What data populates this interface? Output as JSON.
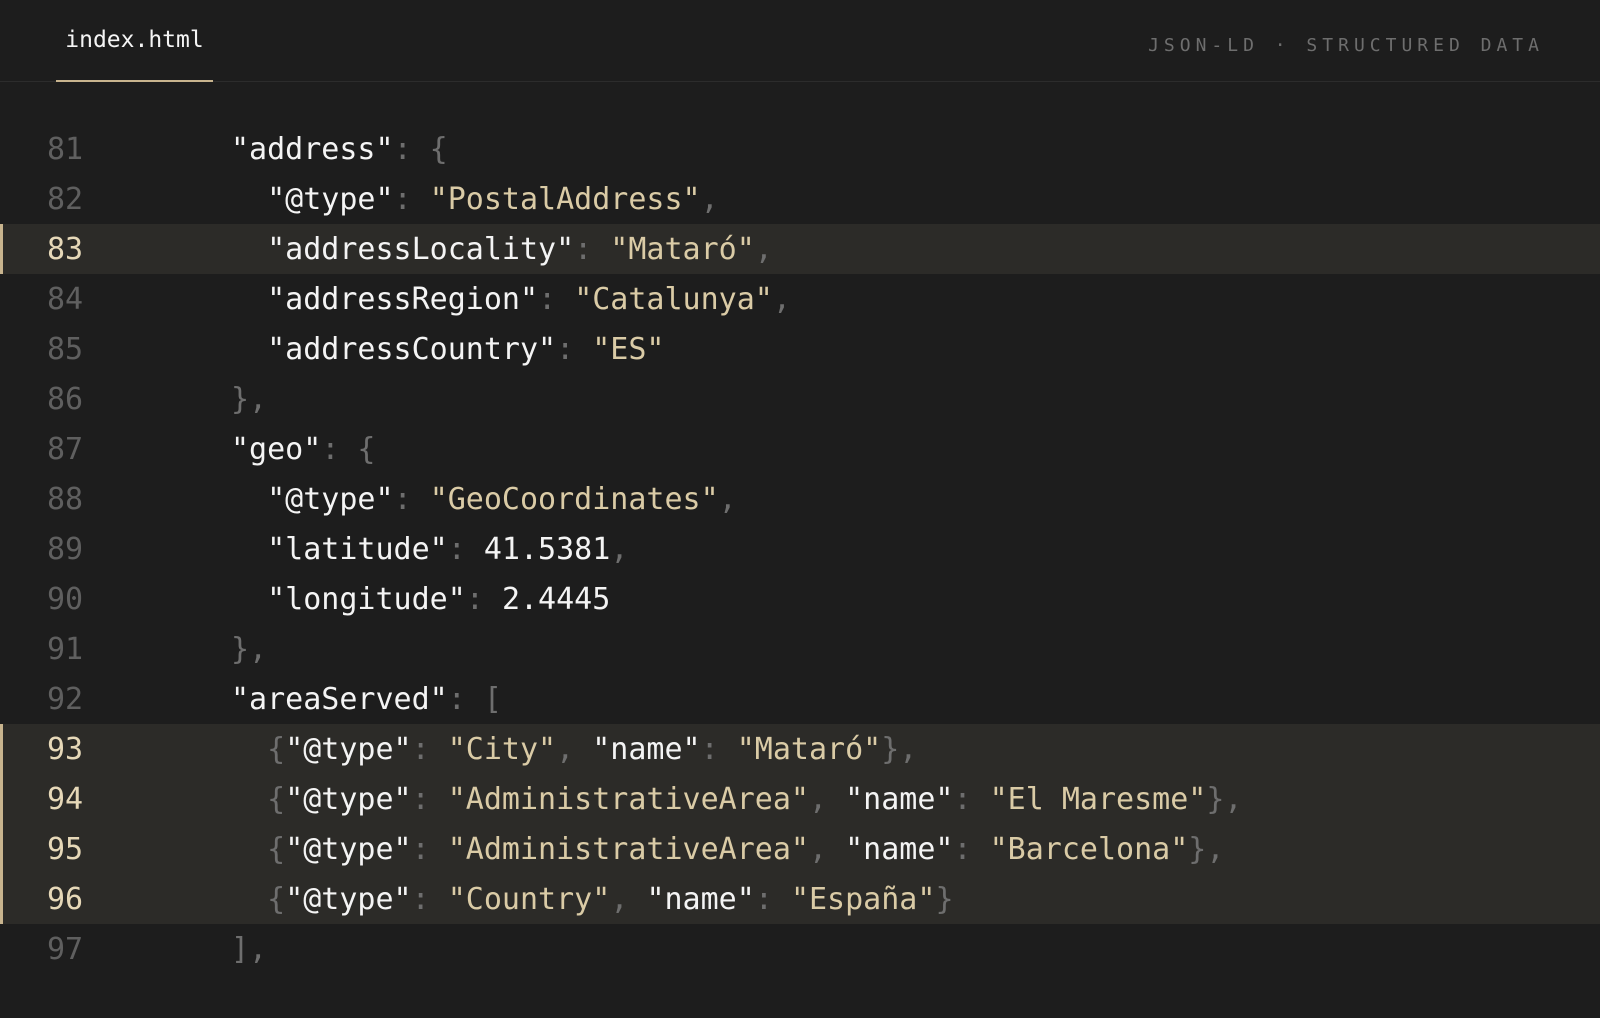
{
  "tab": {
    "label": "index.html"
  },
  "context_label": "JSON-LD · STRUCTURED DATA",
  "lines": [
    {
      "num": "81",
      "highlighted": false,
      "indent": 0,
      "tokens": [
        {
          "t": "k",
          "v": "\"address\""
        },
        {
          "t": "p",
          "v": ": {"
        }
      ]
    },
    {
      "num": "82",
      "highlighted": false,
      "indent": 1,
      "tokens": [
        {
          "t": "k",
          "v": "\"@type\""
        },
        {
          "t": "p",
          "v": ": "
        },
        {
          "t": "s",
          "v": "\"PostalAddress\""
        },
        {
          "t": "p",
          "v": ","
        }
      ]
    },
    {
      "num": "83",
      "highlighted": true,
      "indent": 1,
      "tokens": [
        {
          "t": "k",
          "v": "\"addressLocality\""
        },
        {
          "t": "p",
          "v": ": "
        },
        {
          "t": "s",
          "v": "\"Mataró\""
        },
        {
          "t": "p",
          "v": ","
        }
      ]
    },
    {
      "num": "84",
      "highlighted": false,
      "indent": 1,
      "tokens": [
        {
          "t": "k",
          "v": "\"addressRegion\""
        },
        {
          "t": "p",
          "v": ": "
        },
        {
          "t": "s",
          "v": "\"Catalunya\""
        },
        {
          "t": "p",
          "v": ","
        }
      ]
    },
    {
      "num": "85",
      "highlighted": false,
      "indent": 1,
      "tokens": [
        {
          "t": "k",
          "v": "\"addressCountry\""
        },
        {
          "t": "p",
          "v": ": "
        },
        {
          "t": "s",
          "v": "\"ES\""
        }
      ]
    },
    {
      "num": "86",
      "highlighted": false,
      "indent": 0,
      "tokens": [
        {
          "t": "p",
          "v": "},"
        }
      ]
    },
    {
      "num": "87",
      "highlighted": false,
      "indent": 0,
      "tokens": [
        {
          "t": "k",
          "v": "\"geo\""
        },
        {
          "t": "p",
          "v": ": {"
        }
      ]
    },
    {
      "num": "88",
      "highlighted": false,
      "indent": 1,
      "tokens": [
        {
          "t": "k",
          "v": "\"@type\""
        },
        {
          "t": "p",
          "v": ": "
        },
        {
          "t": "s",
          "v": "\"GeoCoordinates\""
        },
        {
          "t": "p",
          "v": ","
        }
      ]
    },
    {
      "num": "89",
      "highlighted": false,
      "indent": 1,
      "tokens": [
        {
          "t": "k",
          "v": "\"latitude\""
        },
        {
          "t": "p",
          "v": ": "
        },
        {
          "t": "n",
          "v": "41.5381"
        },
        {
          "t": "p",
          "v": ","
        }
      ]
    },
    {
      "num": "90",
      "highlighted": false,
      "indent": 1,
      "tokens": [
        {
          "t": "k",
          "v": "\"longitude\""
        },
        {
          "t": "p",
          "v": ": "
        },
        {
          "t": "n",
          "v": "2.4445"
        }
      ]
    },
    {
      "num": "91",
      "highlighted": false,
      "indent": 0,
      "tokens": [
        {
          "t": "p",
          "v": "},"
        }
      ]
    },
    {
      "num": "92",
      "highlighted": false,
      "indent": 0,
      "tokens": [
        {
          "t": "k",
          "v": "\"areaServed\""
        },
        {
          "t": "p",
          "v": ": ["
        }
      ]
    },
    {
      "num": "93",
      "highlighted": true,
      "indent": 1,
      "tokens": [
        {
          "t": "p",
          "v": "{"
        },
        {
          "t": "k",
          "v": "\"@type\""
        },
        {
          "t": "p",
          "v": ": "
        },
        {
          "t": "s",
          "v": "\"City\""
        },
        {
          "t": "p",
          "v": ", "
        },
        {
          "t": "k",
          "v": "\"name\""
        },
        {
          "t": "p",
          "v": ": "
        },
        {
          "t": "s",
          "v": "\"Mataró\""
        },
        {
          "t": "p",
          "v": "},"
        }
      ]
    },
    {
      "num": "94",
      "highlighted": true,
      "indent": 1,
      "tokens": [
        {
          "t": "p",
          "v": "{"
        },
        {
          "t": "k",
          "v": "\"@type\""
        },
        {
          "t": "p",
          "v": ": "
        },
        {
          "t": "s",
          "v": "\"AdministrativeArea\""
        },
        {
          "t": "p",
          "v": ", "
        },
        {
          "t": "k",
          "v": "\"name\""
        },
        {
          "t": "p",
          "v": ": "
        },
        {
          "t": "s",
          "v": "\"El Maresme\""
        },
        {
          "t": "p",
          "v": "},"
        }
      ]
    },
    {
      "num": "95",
      "highlighted": true,
      "indent": 1,
      "tokens": [
        {
          "t": "p",
          "v": "{"
        },
        {
          "t": "k",
          "v": "\"@type\""
        },
        {
          "t": "p",
          "v": ": "
        },
        {
          "t": "s",
          "v": "\"AdministrativeArea\""
        },
        {
          "t": "p",
          "v": ", "
        },
        {
          "t": "k",
          "v": "\"name\""
        },
        {
          "t": "p",
          "v": ": "
        },
        {
          "t": "s",
          "v": "\"Barcelona\""
        },
        {
          "t": "p",
          "v": "},"
        }
      ]
    },
    {
      "num": "96",
      "highlighted": true,
      "indent": 1,
      "tokens": [
        {
          "t": "p",
          "v": "{"
        },
        {
          "t": "k",
          "v": "\"@type\""
        },
        {
          "t": "p",
          "v": ": "
        },
        {
          "t": "s",
          "v": "\"Country\""
        },
        {
          "t": "p",
          "v": ", "
        },
        {
          "t": "k",
          "v": "\"name\""
        },
        {
          "t": "p",
          "v": ": "
        },
        {
          "t": "s",
          "v": "\"España\""
        },
        {
          "t": "p",
          "v": "}"
        }
      ]
    },
    {
      "num": "97",
      "highlighted": false,
      "indent": 0,
      "tokens": [
        {
          "t": "p",
          "v": "],"
        }
      ]
    }
  ],
  "colors": {
    "background": "#1d1d1d",
    "highlight_background": "#2c2b28",
    "accent": "#c8b48e",
    "string": "#dacba6",
    "key": "#f4f4f4",
    "punctuation": "#6e6e6e",
    "line_number": "#5f5f5f"
  }
}
